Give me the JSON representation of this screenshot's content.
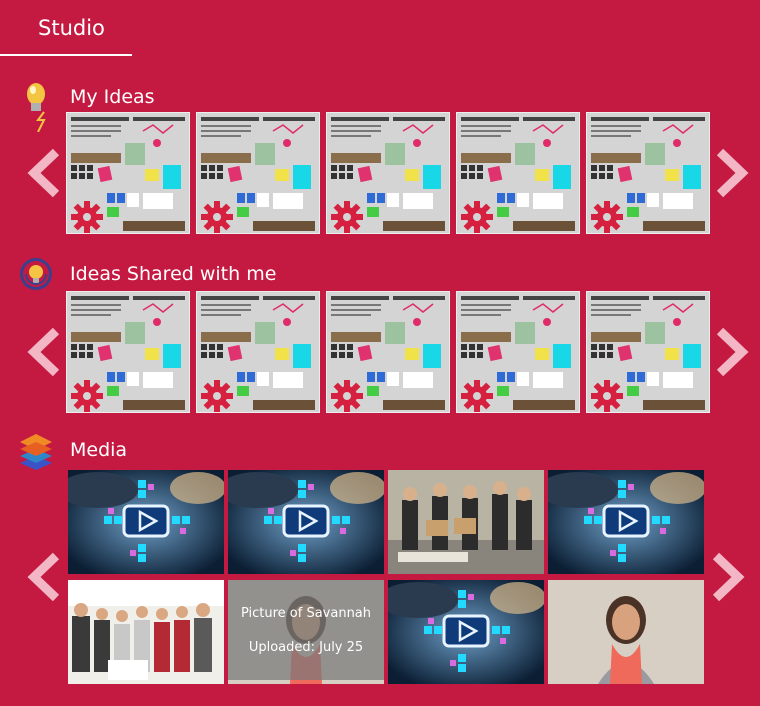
{
  "header": {
    "tab_label": "Studio"
  },
  "sections": {
    "my_ideas": {
      "title": "My Ideas",
      "icon": "lightbulb-icon",
      "count": 5
    },
    "shared": {
      "title": "Ideas Shared with me",
      "icon": "globe-bulb-icon",
      "count": 5
    },
    "media": {
      "title": "Media",
      "icon": "layers-icon"
    }
  },
  "media": {
    "items": [
      {
        "kind": "video-thumbnail"
      },
      {
        "kind": "video-thumbnail"
      },
      {
        "kind": "photo-group"
      },
      {
        "kind": "video-thumbnail"
      },
      {
        "kind": "photo-group"
      },
      {
        "kind": "photo-hover",
        "caption": "Picture of Savannah",
        "uploaded": "Uploaded: July 25"
      },
      {
        "kind": "video-thumbnail"
      },
      {
        "kind": "photo-portrait"
      }
    ]
  },
  "colors": {
    "background": "#c41a42",
    "arrow": "#f2b6c4",
    "text": "#ffffff"
  }
}
